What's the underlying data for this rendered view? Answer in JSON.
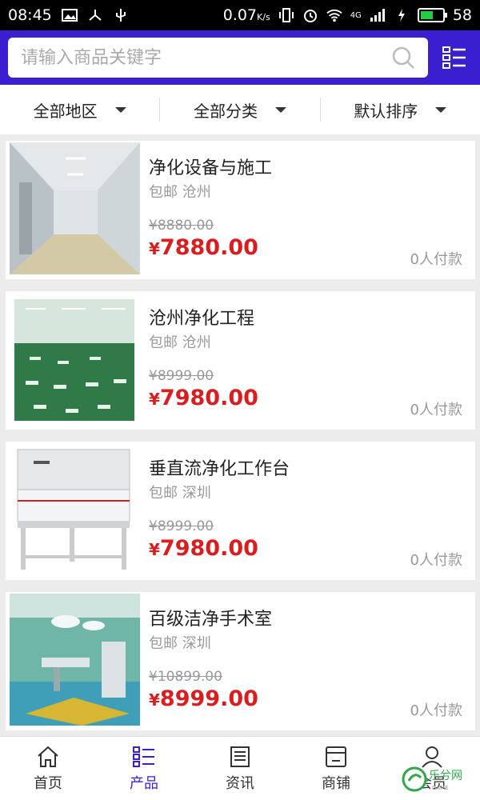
{
  "statusbar": {
    "time": "08:45",
    "speed": "0.07",
    "speed_unit": "K/s",
    "network": "4G",
    "battery": "58",
    "battery_level": 0.58
  },
  "search": {
    "placeholder": "请输入商品关键字"
  },
  "filters": [
    {
      "label": "全部地区"
    },
    {
      "label": "全部分类"
    },
    {
      "label": "默认排序"
    }
  ],
  "products": [
    {
      "title": "净化设备与施工",
      "shipping": "包邮",
      "city": "沧州",
      "original_price": "¥8880.00",
      "price_symbol": "¥",
      "price": "7880.00",
      "sold": "0人付款"
    },
    {
      "title": "沧州净化工程",
      "shipping": "包邮",
      "city": "沧州",
      "original_price": "¥8999.00",
      "price_symbol": "¥",
      "price": "7980.00",
      "sold": "0人付款"
    },
    {
      "title": "垂直流净化工作台",
      "shipping": "包邮",
      "city": "深圳",
      "original_price": "¥8999.00",
      "price_symbol": "¥",
      "price": "7980.00",
      "sold": "0人付款"
    },
    {
      "title": "百级洁净手术室",
      "shipping": "包邮",
      "city": "深圳",
      "original_price": "¥10899.00",
      "price_symbol": "¥",
      "price": "8999.00",
      "sold": "0人付款"
    }
  ],
  "nav": [
    {
      "label": "首页",
      "icon": "home-icon"
    },
    {
      "label": "产品",
      "icon": "list-icon"
    },
    {
      "label": "资讯",
      "icon": "news-icon"
    },
    {
      "label": "商铺",
      "icon": "store-icon"
    },
    {
      "label": "会员",
      "icon": "user-icon"
    }
  ],
  "watermark": {
    "text": "乐兮网",
    "subtext": "GAME"
  },
  "colors": {
    "brand": "#3a1fd0",
    "price": "#d81e1e"
  }
}
